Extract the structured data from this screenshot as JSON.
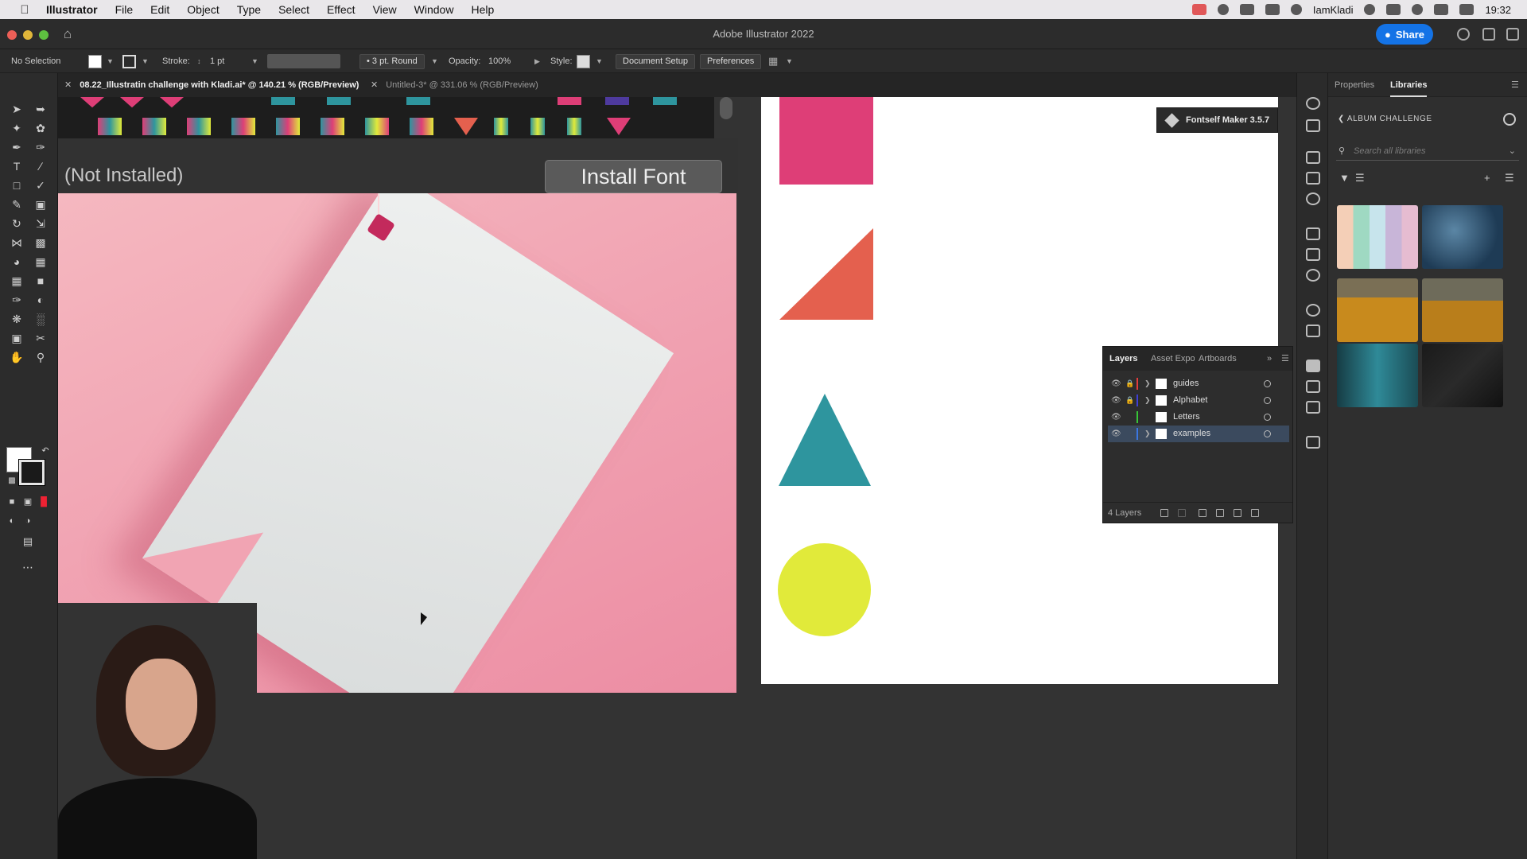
{
  "menubar": {
    "app": "Illustrator",
    "items": [
      "File",
      "Edit",
      "Object",
      "Type",
      "Select",
      "Effect",
      "View",
      "Window",
      "Help"
    ],
    "user": "IamKladi",
    "time": "19:32"
  },
  "titlebar": {
    "title": "Adobe Illustrator 2022",
    "share": "Share"
  },
  "controlbar": {
    "selection": "No Selection",
    "stroke_label": "Stroke:",
    "stroke_value": "1 pt",
    "brush": "3 pt. Round",
    "opacity_label": "Opacity:",
    "opacity_value": "100%",
    "style_label": "Style:",
    "document_setup": "Document Setup",
    "preferences": "Preferences"
  },
  "doc_tabs": [
    {
      "label": "08.22_Illustratin challenge with Kladi.ai* @ 140.21 % (RGB/Preview)",
      "active": true
    },
    {
      "label": "Untitled-3* @ 331.06 % (RGB/Preview)",
      "active": false
    }
  ],
  "font_preview": {
    "status": "(Not Installed)",
    "install_button": "Install Font"
  },
  "fontself": {
    "label": "Fontself Maker 3.5.7"
  },
  "artboard_shapes": [
    {
      "shape": "square",
      "color": "#de3e77"
    },
    {
      "shape": "right-triangle",
      "color": "#e4604e"
    },
    {
      "shape": "triangle",
      "color": "#2e959e"
    },
    {
      "shape": "circle",
      "color": "#e1ea3a"
    }
  ],
  "layers_panel": {
    "tabs": [
      "Layers",
      "Asset Expo",
      "Artboards"
    ],
    "layers": [
      {
        "name": "guides",
        "color": "#e23d3d",
        "locked": true
      },
      {
        "name": "Alphabet",
        "color": "#3f3fd6",
        "locked": true
      },
      {
        "name": "Letters",
        "color": "#37c537",
        "locked": false
      },
      {
        "name": "examples",
        "color": "#3a77e3",
        "locked": false
      }
    ],
    "count": "4 Layers"
  },
  "libraries_panel": {
    "tabs": [
      "Properties",
      "Libraries"
    ],
    "library": "ALBUM CHALLENGE",
    "search_placeholder": "Search all libraries"
  }
}
